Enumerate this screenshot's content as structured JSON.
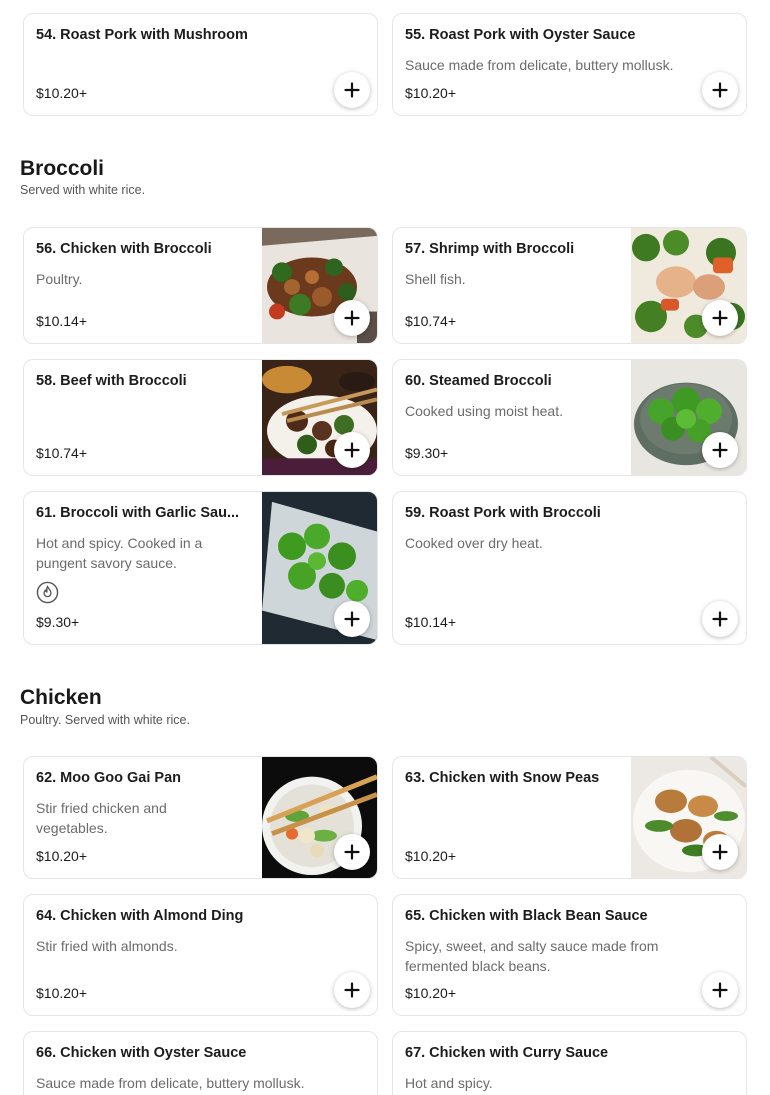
{
  "sections": {
    "broccoli": {
      "title": "Broccoli",
      "subtitle": "Served with white rice."
    },
    "chicken": {
      "title": "Chicken",
      "subtitle": "Poultry. Served with white rice."
    }
  },
  "items": {
    "i54": {
      "name": "54. Roast Pork with Mushroom",
      "desc": "",
      "price": "$10.20+"
    },
    "i55": {
      "name": "55. Roast Pork with Oyster Sauce",
      "desc": "Sauce made from delicate, buttery mollusk.",
      "price": "$10.20+"
    },
    "i56": {
      "name": "56. Chicken with Broccoli",
      "desc": "Poultry.",
      "price": "$10.14+"
    },
    "i57": {
      "name": "57. Shrimp with Broccoli",
      "desc": "Shell fish.",
      "price": "$10.74+"
    },
    "i58": {
      "name": "58. Beef with Broccoli",
      "desc": "",
      "price": "$10.74+"
    },
    "i60": {
      "name": "60. Steamed Broccoli",
      "desc": "Cooked using moist heat.",
      "price": "$9.30+"
    },
    "i61": {
      "name": "61. Broccoli with Garlic Sau...",
      "desc": "Hot and spicy. Cooked in a pungent savory sauce.",
      "price": "$9.30+"
    },
    "i59": {
      "name": "59. Roast Pork with Broccoli",
      "desc": "Cooked over dry heat.",
      "price": "$10.14+"
    },
    "i62": {
      "name": "62. Moo Goo Gai Pan",
      "desc": "Stir fried chicken and vegetables.",
      "price": "$10.20+"
    },
    "i63": {
      "name": "63. Chicken with Snow Peas",
      "desc": "",
      "price": "$10.20+"
    },
    "i64": {
      "name": "64. Chicken with Almond Ding",
      "desc": "Stir fried with almonds.",
      "price": "$10.20+"
    },
    "i65": {
      "name": "65. Chicken with Black Bean Sauce",
      "desc": "Spicy, sweet, and salty sauce made from fermented black beans.",
      "price": "$10.20+"
    },
    "i66": {
      "name": "66. Chicken with Oyster Sauce",
      "desc": "Sauce made from delicate, buttery mollusk.",
      "price": ""
    },
    "i67": {
      "name": "67. Chicken with Curry Sauce",
      "desc": "Hot and spicy.",
      "price": ""
    }
  },
  "icons": {
    "add": "plus-icon",
    "spicy": "flame-icon"
  }
}
